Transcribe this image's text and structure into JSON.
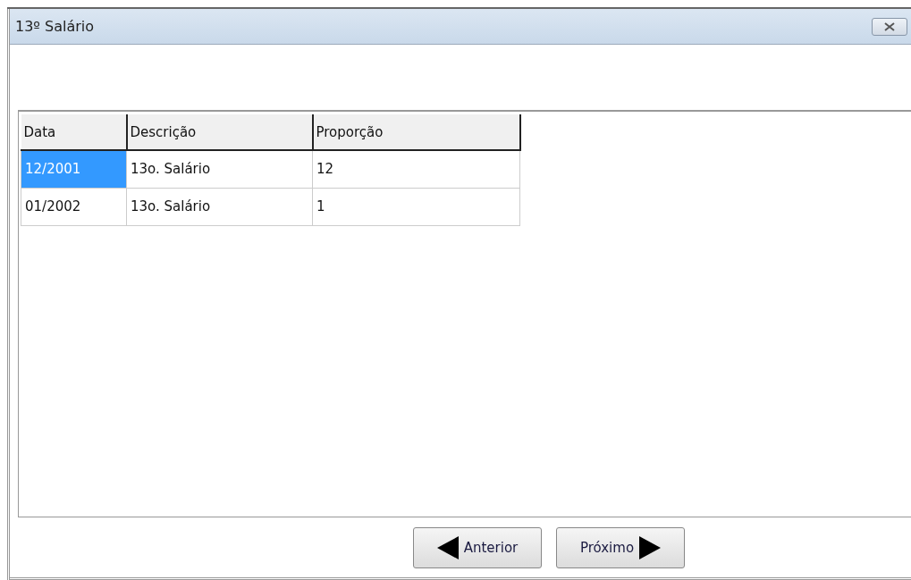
{
  "window": {
    "title": "13º Salário"
  },
  "table": {
    "columns": [
      "Data",
      "Descrição",
      "Proporção"
    ],
    "rows": [
      {
        "selected": true,
        "cells": [
          "12/2001",
          "13o. Salário",
          "12"
        ]
      },
      {
        "selected": false,
        "cells": [
          "01/2002",
          "13o. Salário",
          "1"
        ]
      }
    ]
  },
  "buttons": [
    {
      "kind": "previous",
      "label": "Anterior"
    },
    {
      "kind": "next",
      "label": "Próximo"
    }
  ]
}
